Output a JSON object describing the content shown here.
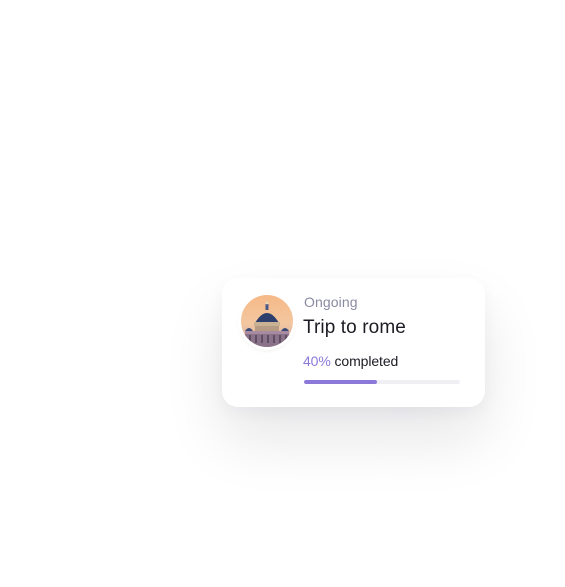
{
  "trip_card": {
    "status": "Ongoing",
    "title": "Trip to rome",
    "progress_percent_label": "40%",
    "progress_suffix": "completed",
    "progress_fraction": 0.47,
    "image_icon": "st-peters-basilica-photo"
  },
  "colors": {
    "accent": "#8b78d9",
    "status_text": "#8a8aa3",
    "title_text": "#1c1c24",
    "track": "#f0f0f4"
  }
}
